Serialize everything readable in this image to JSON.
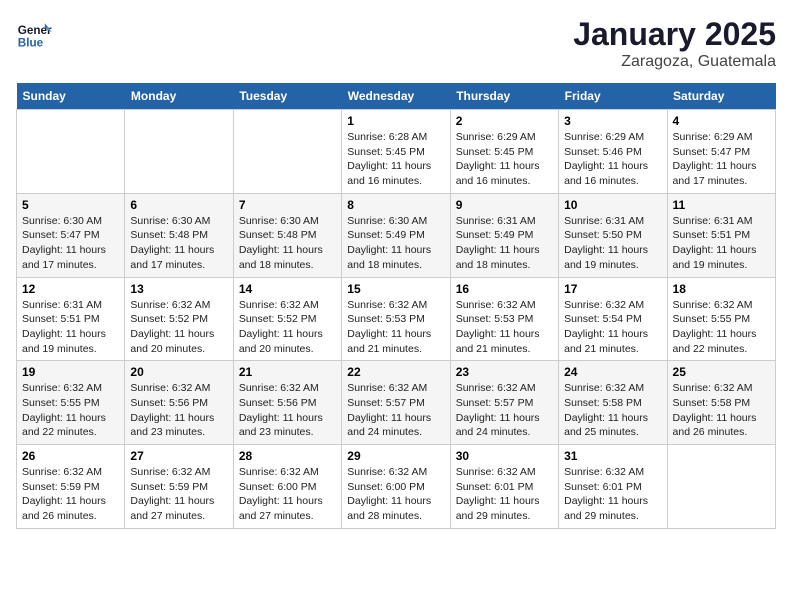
{
  "logo": {
    "line1": "General",
    "line2": "Blue"
  },
  "title": "January 2025",
  "location": "Zaragoza, Guatemala",
  "days_of_week": [
    "Sunday",
    "Monday",
    "Tuesday",
    "Wednesday",
    "Thursday",
    "Friday",
    "Saturday"
  ],
  "weeks": [
    [
      {
        "day": "",
        "sunrise": "",
        "sunset": "",
        "daylight": ""
      },
      {
        "day": "",
        "sunrise": "",
        "sunset": "",
        "daylight": ""
      },
      {
        "day": "",
        "sunrise": "",
        "sunset": "",
        "daylight": ""
      },
      {
        "day": "1",
        "sunrise": "Sunrise: 6:28 AM",
        "sunset": "Sunset: 5:45 PM",
        "daylight": "Daylight: 11 hours and 16 minutes."
      },
      {
        "day": "2",
        "sunrise": "Sunrise: 6:29 AM",
        "sunset": "Sunset: 5:45 PM",
        "daylight": "Daylight: 11 hours and 16 minutes."
      },
      {
        "day": "3",
        "sunrise": "Sunrise: 6:29 AM",
        "sunset": "Sunset: 5:46 PM",
        "daylight": "Daylight: 11 hours and 16 minutes."
      },
      {
        "day": "4",
        "sunrise": "Sunrise: 6:29 AM",
        "sunset": "Sunset: 5:47 PM",
        "daylight": "Daylight: 11 hours and 17 minutes."
      }
    ],
    [
      {
        "day": "5",
        "sunrise": "Sunrise: 6:30 AM",
        "sunset": "Sunset: 5:47 PM",
        "daylight": "Daylight: 11 hours and 17 minutes."
      },
      {
        "day": "6",
        "sunrise": "Sunrise: 6:30 AM",
        "sunset": "Sunset: 5:48 PM",
        "daylight": "Daylight: 11 hours and 17 minutes."
      },
      {
        "day": "7",
        "sunrise": "Sunrise: 6:30 AM",
        "sunset": "Sunset: 5:48 PM",
        "daylight": "Daylight: 11 hours and 18 minutes."
      },
      {
        "day": "8",
        "sunrise": "Sunrise: 6:30 AM",
        "sunset": "Sunset: 5:49 PM",
        "daylight": "Daylight: 11 hours and 18 minutes."
      },
      {
        "day": "9",
        "sunrise": "Sunrise: 6:31 AM",
        "sunset": "Sunset: 5:49 PM",
        "daylight": "Daylight: 11 hours and 18 minutes."
      },
      {
        "day": "10",
        "sunrise": "Sunrise: 6:31 AM",
        "sunset": "Sunset: 5:50 PM",
        "daylight": "Daylight: 11 hours and 19 minutes."
      },
      {
        "day": "11",
        "sunrise": "Sunrise: 6:31 AM",
        "sunset": "Sunset: 5:51 PM",
        "daylight": "Daylight: 11 hours and 19 minutes."
      }
    ],
    [
      {
        "day": "12",
        "sunrise": "Sunrise: 6:31 AM",
        "sunset": "Sunset: 5:51 PM",
        "daylight": "Daylight: 11 hours and 19 minutes."
      },
      {
        "day": "13",
        "sunrise": "Sunrise: 6:32 AM",
        "sunset": "Sunset: 5:52 PM",
        "daylight": "Daylight: 11 hours and 20 minutes."
      },
      {
        "day": "14",
        "sunrise": "Sunrise: 6:32 AM",
        "sunset": "Sunset: 5:52 PM",
        "daylight": "Daylight: 11 hours and 20 minutes."
      },
      {
        "day": "15",
        "sunrise": "Sunrise: 6:32 AM",
        "sunset": "Sunset: 5:53 PM",
        "daylight": "Daylight: 11 hours and 21 minutes."
      },
      {
        "day": "16",
        "sunrise": "Sunrise: 6:32 AM",
        "sunset": "Sunset: 5:53 PM",
        "daylight": "Daylight: 11 hours and 21 minutes."
      },
      {
        "day": "17",
        "sunrise": "Sunrise: 6:32 AM",
        "sunset": "Sunset: 5:54 PM",
        "daylight": "Daylight: 11 hours and 21 minutes."
      },
      {
        "day": "18",
        "sunrise": "Sunrise: 6:32 AM",
        "sunset": "Sunset: 5:55 PM",
        "daylight": "Daylight: 11 hours and 22 minutes."
      }
    ],
    [
      {
        "day": "19",
        "sunrise": "Sunrise: 6:32 AM",
        "sunset": "Sunset: 5:55 PM",
        "daylight": "Daylight: 11 hours and 22 minutes."
      },
      {
        "day": "20",
        "sunrise": "Sunrise: 6:32 AM",
        "sunset": "Sunset: 5:56 PM",
        "daylight": "Daylight: 11 hours and 23 minutes."
      },
      {
        "day": "21",
        "sunrise": "Sunrise: 6:32 AM",
        "sunset": "Sunset: 5:56 PM",
        "daylight": "Daylight: 11 hours and 23 minutes."
      },
      {
        "day": "22",
        "sunrise": "Sunrise: 6:32 AM",
        "sunset": "Sunset: 5:57 PM",
        "daylight": "Daylight: 11 hours and 24 minutes."
      },
      {
        "day": "23",
        "sunrise": "Sunrise: 6:32 AM",
        "sunset": "Sunset: 5:57 PM",
        "daylight": "Daylight: 11 hours and 24 minutes."
      },
      {
        "day": "24",
        "sunrise": "Sunrise: 6:32 AM",
        "sunset": "Sunset: 5:58 PM",
        "daylight": "Daylight: 11 hours and 25 minutes."
      },
      {
        "day": "25",
        "sunrise": "Sunrise: 6:32 AM",
        "sunset": "Sunset: 5:58 PM",
        "daylight": "Daylight: 11 hours and 26 minutes."
      }
    ],
    [
      {
        "day": "26",
        "sunrise": "Sunrise: 6:32 AM",
        "sunset": "Sunset: 5:59 PM",
        "daylight": "Daylight: 11 hours and 26 minutes."
      },
      {
        "day": "27",
        "sunrise": "Sunrise: 6:32 AM",
        "sunset": "Sunset: 5:59 PM",
        "daylight": "Daylight: 11 hours and 27 minutes."
      },
      {
        "day": "28",
        "sunrise": "Sunrise: 6:32 AM",
        "sunset": "Sunset: 6:00 PM",
        "daylight": "Daylight: 11 hours and 27 minutes."
      },
      {
        "day": "29",
        "sunrise": "Sunrise: 6:32 AM",
        "sunset": "Sunset: 6:00 PM",
        "daylight": "Daylight: 11 hours and 28 minutes."
      },
      {
        "day": "30",
        "sunrise": "Sunrise: 6:32 AM",
        "sunset": "Sunset: 6:01 PM",
        "daylight": "Daylight: 11 hours and 29 minutes."
      },
      {
        "day": "31",
        "sunrise": "Sunrise: 6:32 AM",
        "sunset": "Sunset: 6:01 PM",
        "daylight": "Daylight: 11 hours and 29 minutes."
      },
      {
        "day": "",
        "sunrise": "",
        "sunset": "",
        "daylight": ""
      }
    ]
  ]
}
